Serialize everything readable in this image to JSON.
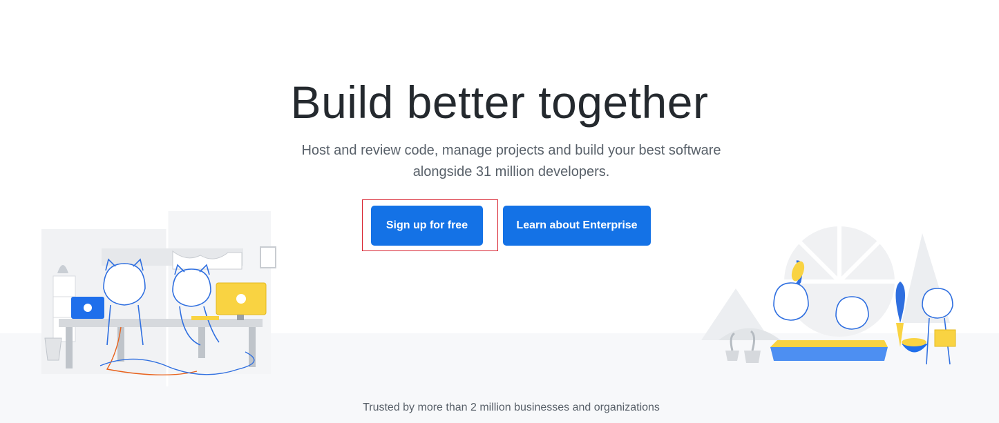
{
  "hero": {
    "title": "Build better together",
    "subtitle_line1": "Host and review code, manage projects and build your best software",
    "subtitle_line2": "alongside 31 million developers."
  },
  "buttons": {
    "signup_label": "Sign up for free",
    "enterprise_label": "Learn about Enterprise"
  },
  "footer": {
    "trusted_text": "Trusted by more than 2 million businesses and organizations"
  },
  "colors": {
    "accent": "#1472e6",
    "highlight": "#d7202d",
    "title": "#24292e",
    "muted": "#586069",
    "illustration_yellow": "#f9d342",
    "illustration_blue": "#1f6feb"
  },
  "illustrations": {
    "left": "octocats-at-desk-illustration",
    "right": "octocats-gardening-illustration"
  }
}
